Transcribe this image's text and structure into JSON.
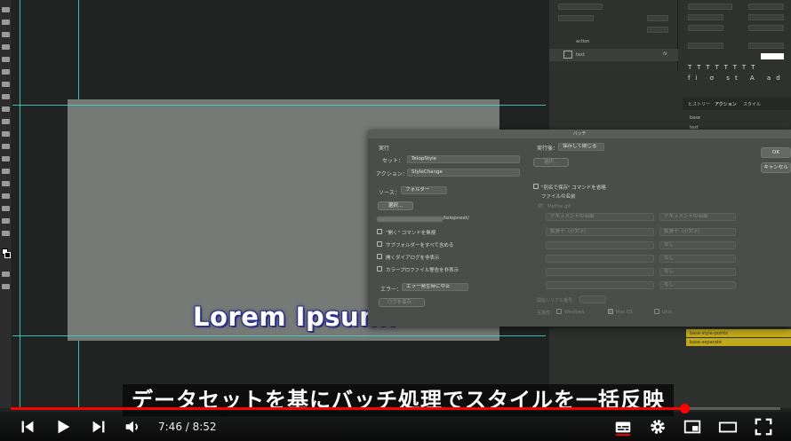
{
  "canvas": {
    "overlay_text": "Lorem Ipsum."
  },
  "batch_dialog": {
    "title": "バッチ",
    "play_section": "実行",
    "set_label": "セット：",
    "set_value": "TelopStyle",
    "action_label": "アクション：",
    "action_value": "StyleChange",
    "source_label": "ソース：",
    "source_value": "フォルダー",
    "choose_button": "選択...",
    "source_path": "/telopnext/",
    "checkboxes": [
      "\"開く\" コマンドを無視",
      "サブフォルダーをすべて含める",
      "開くダイアログを非表示",
      "カラープロファイル警告を非表示"
    ],
    "error_label": "エラー：",
    "error_value": "エラー発生時に中止",
    "save_log_button": "ログを保存...",
    "destination_label": "実行後：",
    "destination_value": "保存して閉じる",
    "dest_choose_button": "選択...",
    "override_save_label": "\"別名で保存\" コマンドを省略",
    "file_naming_label": "ファイルの名前",
    "example_label": "例：MyFile.gif",
    "naming_rows": [
      [
        "ドキュメントの名前",
        "ドキュメントの名前"
      ],
      [
        "拡張子（小文字）",
        "拡張子（小文字）"
      ],
      [
        "",
        "なし"
      ],
      [
        "",
        "なし"
      ],
      [
        "",
        "なし"
      ],
      [
        "",
        "なし"
      ]
    ],
    "serial_label": "開始シリアル番号：",
    "compat_label": "互換性：",
    "compat_options": [
      "Windows",
      "Mac OS",
      "Unix"
    ],
    "ok_button": "OK",
    "cancel_button": "キャンセル"
  },
  "layers_panel": {
    "layer_rows": [
      "action",
      "text"
    ],
    "fx_label": "fx"
  },
  "history_tabs": [
    "ヒストリー",
    "アクション",
    "スタイル"
  ],
  "history_items": [
    "base",
    "text"
  ],
  "actions_list": [
    "base-style-points",
    "base-separate"
  ],
  "subtitle": "データセットを基にバッチ処理でスタイルを一括反映",
  "player": {
    "current_time": "7:46",
    "duration": "8:52",
    "time_display": "7:46 / 8:52",
    "progress": 0.875
  },
  "colors": {
    "progress": "#ff0000",
    "guide": "#3fd8c7",
    "telop_outline": "#2a2f88",
    "action_highlight": "#c1a91a"
  }
}
